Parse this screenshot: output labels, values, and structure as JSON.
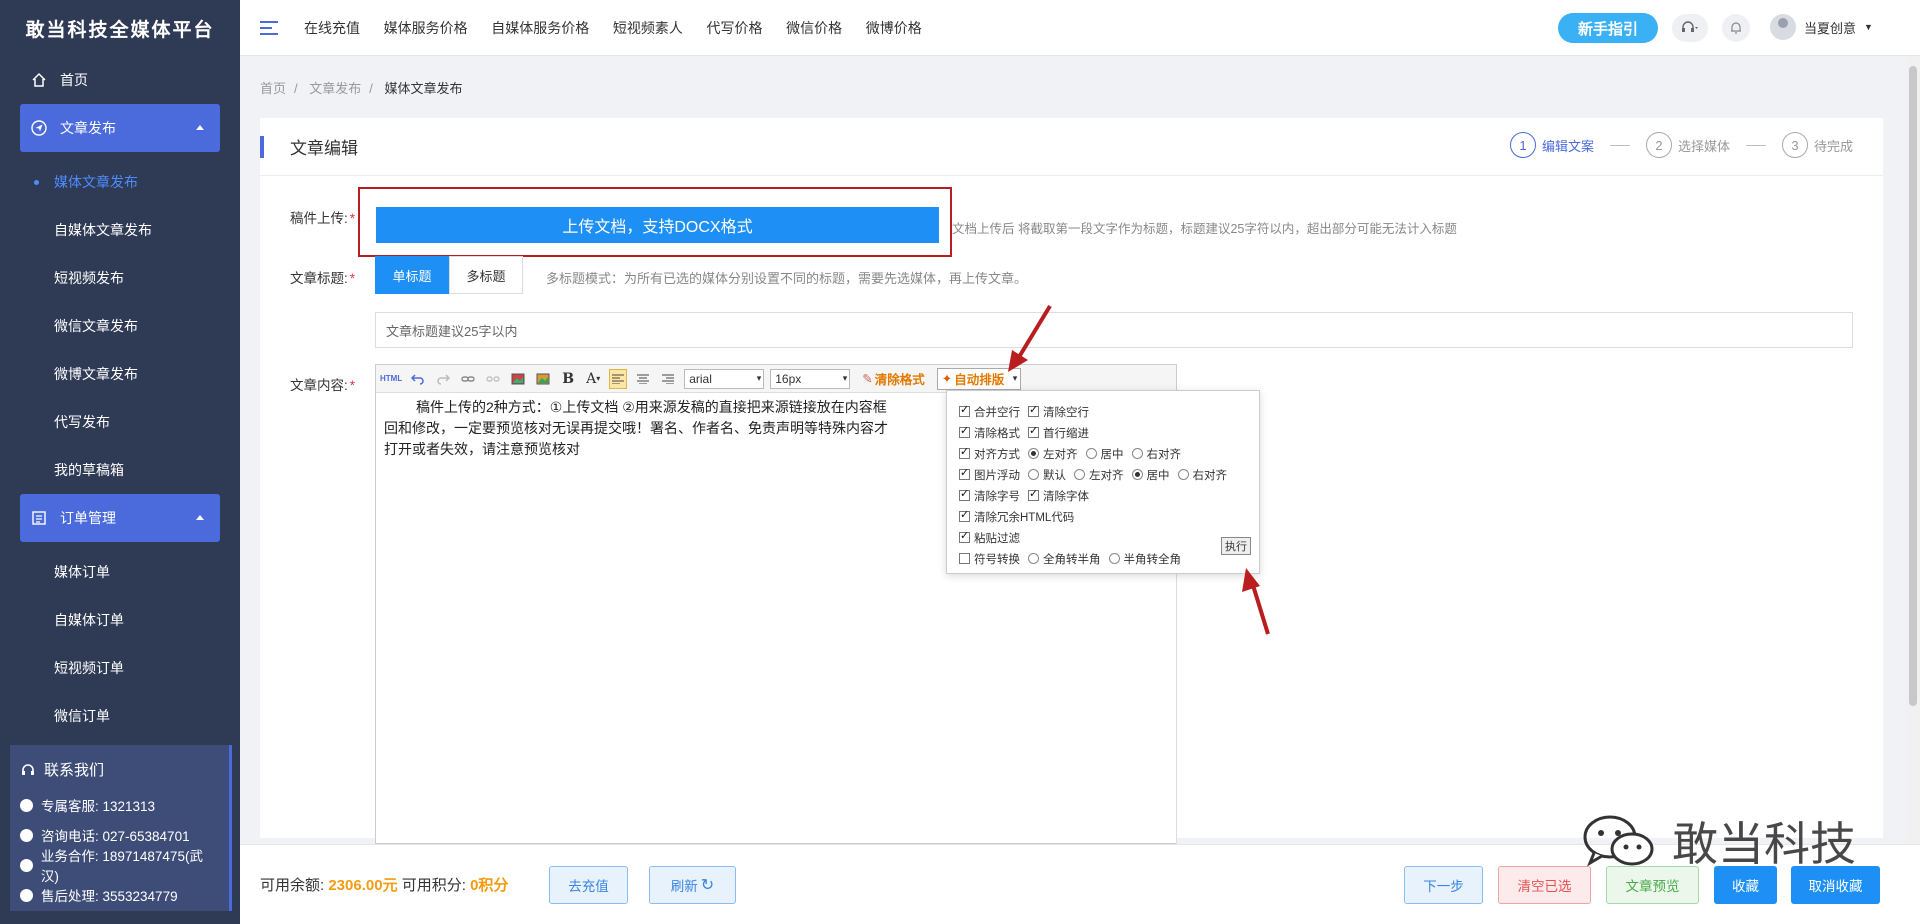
{
  "sidebar": {
    "brand": "敢当科技全媒体平台",
    "home": "首页",
    "group_article": "文章发布",
    "article_items": [
      "媒体文章发布",
      "自媒体文章发布",
      "短视频发布",
      "微信文章发布",
      "微博文章发布",
      "代写发布",
      "我的草稿箱"
    ],
    "group_order": "订单管理",
    "order_items": [
      "媒体订单",
      "自媒体订单",
      "短视频订单",
      "微信订单"
    ],
    "contact": {
      "title": "联系我们",
      "rows": [
        "专属客服: 1321313",
        "咨询电话: 027-65384701",
        "业务合作: 18971487475(武汉)",
        "售后处理: 3553234779"
      ]
    }
  },
  "topbar": {
    "nav": [
      "在线充值",
      "媒体服务价格",
      "自媒体服务价格",
      "短视频素人",
      "代写价格",
      "微信价格",
      "微博价格"
    ],
    "guide": "新手指引",
    "username": "当夏创意"
  },
  "breadcrumb": [
    "首页",
    "文章发布",
    "媒体文章发布"
  ],
  "card": {
    "title": "文章编辑",
    "steps": [
      {
        "num": "1",
        "label": "编辑文案"
      },
      {
        "num": "2",
        "label": "选择媒体"
      },
      {
        "num": "3",
        "label": "待完成"
      }
    ]
  },
  "form": {
    "upload_label": "稿件上传:",
    "upload_btn": "上传文档，支持DOCX格式",
    "upload_tip": "文档上传后 将截取第一段文字作为标题，标题建议25字符以内，超出部分可能无法计入标题",
    "title_label": "文章标题:",
    "single_title": "单标题",
    "multi_title": "多标题",
    "multi_tip": "多标题模式：为所有已选的媒体分别设置不同的标题，需要先选媒体，再上传文章。",
    "title_placeholder": "文章标题建议25字以内",
    "content_label": "文章内容:"
  },
  "editor": {
    "html_btn": "HTML",
    "font": "arial",
    "size": "16px",
    "clear_format": "清除格式",
    "auto_format": "自动排版",
    "body_lines": [
      "稿件上传的2种方式：①上传文档 ②用来源发稿的直接把来源链接放在内容框",
      "回和修改，一定要预览核对无误再提交哦！署名、作者名、免责声明等特殊内容才",
      "打开或者失效，请注意预览核对"
    ]
  },
  "popup": {
    "merge_blank": "合并空行",
    "clear_blank": "清除空行",
    "clear_style": "清除格式",
    "indent": "首行缩进",
    "align_mode": "对齐方式",
    "align_left": "左对齐",
    "align_center": "居中",
    "align_right": "右对齐",
    "img_float": "图片浮动",
    "img_default": "默认",
    "img_left": "左对齐",
    "img_center": "居中",
    "img_right": "右对齐",
    "clear_size": "清除字号",
    "clear_font": "清除字体",
    "clear_html": "清除冗余HTML代码",
    "paste_filter": "粘贴过滤",
    "symbol_convert": "符号转换",
    "full_to_half": "全角转半角",
    "half_to_full": "半角转全角",
    "execute": "执行"
  },
  "footer": {
    "balance_label": "可用余额:",
    "balance": "2306.00元",
    "points_label": "可用积分:",
    "points": "0积分",
    "recharge": "去充值",
    "refresh": "刷新",
    "next": "下一步",
    "clear_selected": "清空已选",
    "preview": "文章预览",
    "favorite": "收藏",
    "unfavorite": "取消收藏"
  },
  "watermark": "敢当科技",
  "colors": {
    "sidebar_bg": "#2f3a55",
    "accent": "#4b6bdc",
    "primary": "#1e90f5",
    "annotation_red": "#b91d1d",
    "balance": "#f39c12"
  }
}
